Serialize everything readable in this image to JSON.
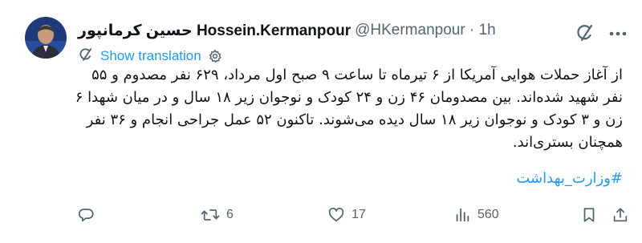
{
  "author": {
    "display_name": "حسین کرمانپور Hossein.Kermanpour",
    "handle": "@HKermanpour",
    "separator": "·",
    "time": "1h"
  },
  "translation": {
    "label": "Show translation"
  },
  "body": {
    "text": "از آغاز حملات هوایی آمریکا از ۶ تیرماه تا ساعت ۹ صبح اول مرداد، ۶۲۹ نفر مصدوم و ۵۵ نفر شهید شده‌اند. بین مصدومان ۴۶ زن و ۲۴ کودک و نوجوان زیر ۱۸ سال و در میان شهدا ۶ زن و ۳ کودک و نوجوان زیر ۱۸ سال دیده می‌شوند. تاکنون ۵۲ عمل جراحی انجام و ۳۶ نفر همچنان بستری‌اند.",
    "hashtag": "#وزارت_بهداشت"
  },
  "actions": {
    "reply": {
      "icon": "reply-icon",
      "count": ""
    },
    "retweet": {
      "icon": "retweet-icon",
      "count": "6"
    },
    "like": {
      "icon": "heart-icon",
      "count": "17"
    },
    "views": {
      "icon": "views-icon",
      "count": "560"
    },
    "bookmark": {
      "icon": "bookmark-icon",
      "count": ""
    },
    "share": {
      "icon": "share-icon",
      "count": ""
    }
  },
  "colors": {
    "link": "#1d9bf0",
    "muted": "#536471",
    "text": "#0f1419"
  }
}
